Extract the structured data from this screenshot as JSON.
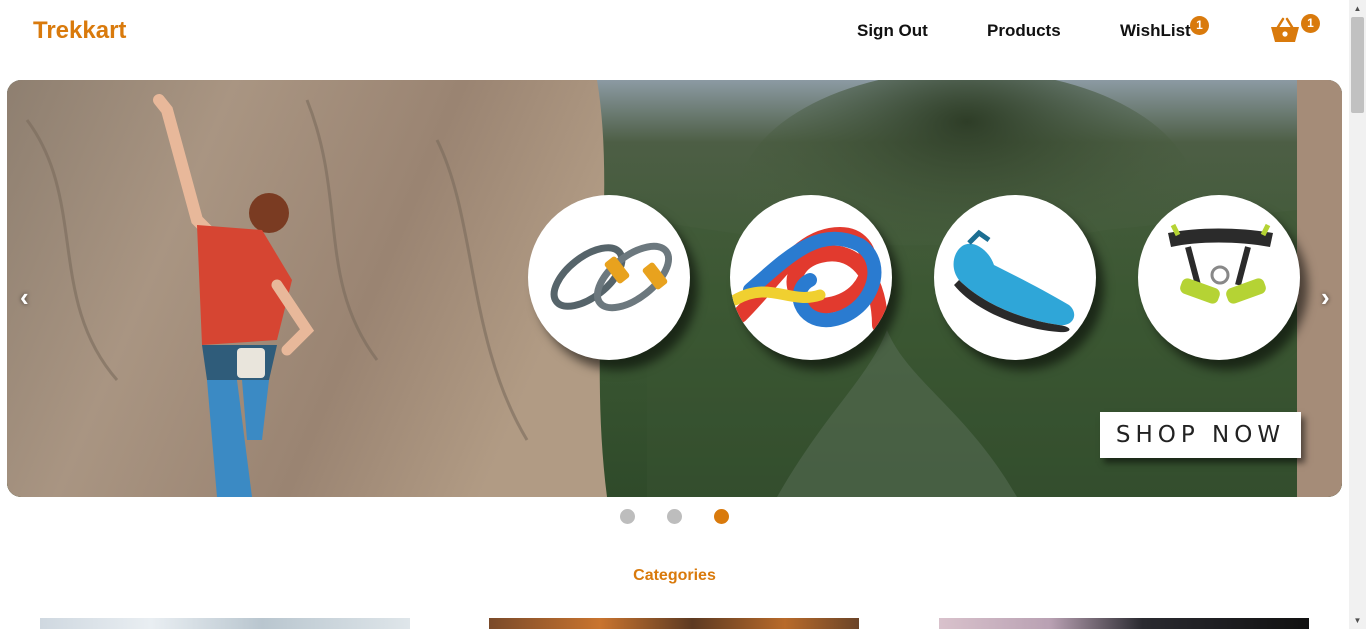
{
  "header": {
    "logo": "Trekkart",
    "nav": {
      "sign_out": "Sign Out",
      "products": "Products",
      "wishlist": "WishList"
    },
    "wishlist_count": "1",
    "cart_count": "1",
    "cart_icon": "basket-icon"
  },
  "carousel": {
    "prev_arrow": "‹",
    "next_arrow": "›",
    "cta": "SHOP NOW",
    "products": [
      "carabiner-icon",
      "rope-icon",
      "climbing-shoe-icon",
      "harness-icon"
    ],
    "active_slide": 3,
    "slide_count": 3
  },
  "categories": {
    "title": "Categories"
  },
  "colors": {
    "accent": "#d97a0c",
    "dot_inactive": "#bdbdbd"
  }
}
